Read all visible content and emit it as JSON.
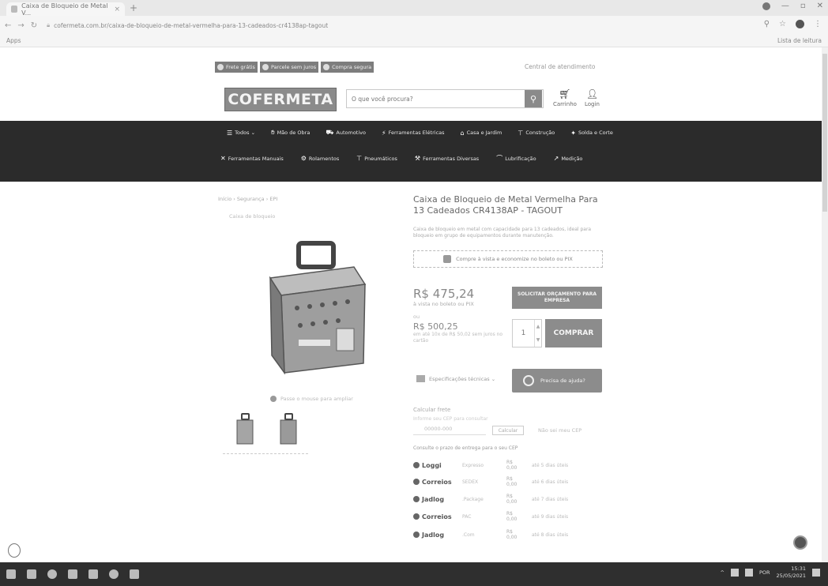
{
  "browser": {
    "tab_title": "Caixa de Bloqueio de Metal V...",
    "new_tab": "+",
    "url": "cofermeta.com.br/caixa-de-bloqueio-de-metal-vermelha-para-13-cadeados-cr4138ap-tagout",
    "bookmarks_left": "Apps",
    "bookmarks_right": "Lista de leitura"
  },
  "promo_bar": [
    {
      "icon": "truck-icon",
      "label": "Frete grátis"
    },
    {
      "icon": "card-icon",
      "label": "Parcele sem juros"
    },
    {
      "icon": "shield-icon",
      "label": "Compra segura"
    }
  ],
  "contact_top": "Central de atendimento",
  "logo": "COFERMETA",
  "search": {
    "placeholder": "O que você procura?"
  },
  "header_icons": {
    "cart": "Carrinho",
    "login": "Login"
  },
  "nav": {
    "row1": [
      {
        "icon": "menu-icon",
        "label": "Todos ⌄"
      },
      {
        "icon": "hand-icon",
        "label": "Mão de Obra"
      },
      {
        "icon": "car-icon",
        "label": "Automotivo"
      },
      {
        "icon": "drill-icon",
        "label": "Ferramentas Elétricas"
      },
      {
        "icon": "house-icon",
        "label": "Casa e Jardim"
      },
      {
        "icon": "crane-icon",
        "label": "Construção"
      },
      {
        "icon": "weld-icon",
        "label": "Solda e Corte"
      }
    ],
    "row2": [
      {
        "icon": "wrench-icon",
        "label": "Ferramentas Manuais"
      },
      {
        "icon": "gear-icon",
        "label": "Rolamentos"
      },
      {
        "icon": "air-icon",
        "label": "Pneumáticos"
      },
      {
        "icon": "tools-icon",
        "label": "Ferramentas Diversas"
      },
      {
        "icon": "oil-icon",
        "label": "Lubrificação"
      },
      {
        "icon": "ruler-icon",
        "label": "Medição"
      }
    ]
  },
  "breadcrumb": "Início › Segurança › EPI",
  "breadcrumb2": "Caixa de bloqueio",
  "product": {
    "title": "Caixa de Bloqueio de Metal Vermelha Para 13 Cadeados CR4138AP - TAGOUT",
    "desc": "Caixa de bloqueio em metal com capacidade para 13 cadeados, ideal para bloqueio em grupo de equipamentos durante manutenção.",
    "promo_box": "Compre à vista e economize no boleto ou PIX",
    "price_main": "R$ 475,24",
    "price_main_sub": "à vista no boleto ou PIX",
    "quote_btn": "SOLICITAR ORÇAMENTO PARA EMPRESA",
    "price_or": "ou",
    "price_alt": "R$ 500,25",
    "price_alt_sub": "em até 10x de R$ 50,02 sem juros no cartão",
    "qty": "1",
    "buy_btn": "COMPRAR",
    "specs_link": "Especificações técnicas ⌄",
    "help_btn": "Precisa de ajuda?",
    "zoom_hint": "Passe o mouse para ampliar"
  },
  "freight": {
    "title": "Calcular frete",
    "sub": "Informe seu CEP para consultar",
    "input_placeholder": "00000-000",
    "btn": "Calcular",
    "link": "Não sei meu CEP",
    "cep_link": "Consulte o prazo de entrega para o seu CEP",
    "options": [
      {
        "carrier": "Loggi",
        "icon": "loggi-icon",
        "svc": "Expresso",
        "price": "R$ 0,00",
        "eta": "até 5 dias úteis"
      },
      {
        "carrier": "Correios",
        "icon": "correios-icon",
        "svc": "SEDEX",
        "price": "R$ 0,00",
        "eta": "até 6 dias úteis"
      },
      {
        "carrier": "Jadlog",
        "icon": "jadlog-icon",
        "svc": ".Package",
        "price": "R$ 0,00",
        "eta": "até 7 dias úteis"
      },
      {
        "carrier": "Correios",
        "icon": "correios-icon",
        "svc": "PAC",
        "price": "R$ 0,00",
        "eta": "até 9 dias úteis"
      },
      {
        "carrier": "Jadlog",
        "icon": "jadlog-icon",
        "svc": ".Com",
        "price": "R$ 0,00",
        "eta": "até 8 dias úteis"
      }
    ]
  },
  "taskbar": {
    "time": "15:31",
    "date": "25/05/2021",
    "lang": "POR"
  },
  "colors": {
    "nav_bg": "#2b2b2b",
    "button_bg": "#8c8c8c",
    "logo_bg": "#8b8b8b"
  }
}
